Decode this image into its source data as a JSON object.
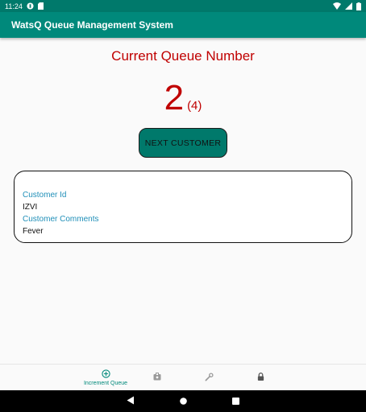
{
  "status_bar": {
    "time": "11:24"
  },
  "app_bar": {
    "title": "WatsQ Queue Management System"
  },
  "queue": {
    "heading": "Current Queue Number",
    "number": "2",
    "total": "(4)"
  },
  "actions": {
    "next_label": "NEXT CUSTOMER"
  },
  "customer": {
    "id_label": "Customer Id",
    "id_value": "IZVI",
    "comments_label": "Customer Comments",
    "comments_value": "Fever"
  },
  "bottom_nav": {
    "items": [
      {
        "label": "Increment Queue",
        "icon": "add-circle-icon",
        "active": true
      },
      {
        "label": "",
        "icon": "badge-icon",
        "active": false
      },
      {
        "label": "",
        "icon": "wrench-icon",
        "active": false
      },
      {
        "label": "",
        "icon": "lock-icon",
        "active": false
      }
    ]
  },
  "colors": {
    "primary": "#00897b",
    "primary_dark": "#00796b",
    "queue_red": "#c00000",
    "label_blue": "#1f8fb8"
  }
}
